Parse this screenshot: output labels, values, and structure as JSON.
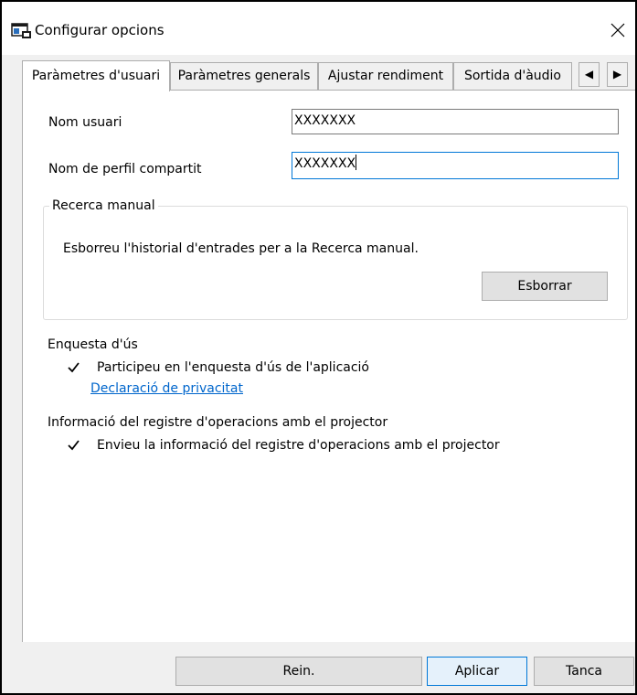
{
  "window": {
    "title": "Configurar opcions",
    "close_icon": "close-icon",
    "app_icon": "settings-app-icon"
  },
  "tabs": [
    {
      "label": "Paràmetres d'usuari",
      "active": true
    },
    {
      "label": "Paràmetres generals",
      "active": false
    },
    {
      "label": "Ajustar rendiment",
      "active": false
    },
    {
      "label": "Sortida d'àudio",
      "active": false
    }
  ],
  "tab_scroll": {
    "left": "◀",
    "right": "▶"
  },
  "user_settings": {
    "username_label": "Nom usuari",
    "username_value": "XXXXXXX",
    "shared_profile_label": "Nom de perfil compartit",
    "shared_profile_value": "XXXXXXX"
  },
  "manual_search": {
    "group_title": "Recerca manual",
    "description": "Esborreu l'historial d'entrades per a la Recerca manual.",
    "clear_button": "Esborrar"
  },
  "usage_survey": {
    "heading": "Enquesta d'ús",
    "checkbox_label": "Participeu en l'enquesta d'ús de l'aplicació",
    "checked": true,
    "privacy_link": "Declaració de privacitat"
  },
  "operation_log": {
    "heading": "Informació del registre d'operacions amb el projector",
    "checkbox_label": "Envieu la informació del registre d'operacions amb el projector",
    "checked": true
  },
  "footer": {
    "reset_button": "Rein.",
    "apply_button": "Aplicar",
    "close_button": "Tanca"
  },
  "colors": {
    "accent": "#0078d7",
    "link": "#0066cc",
    "dialog_bg": "#f0f0f0",
    "panel_bg": "#ffffff"
  }
}
